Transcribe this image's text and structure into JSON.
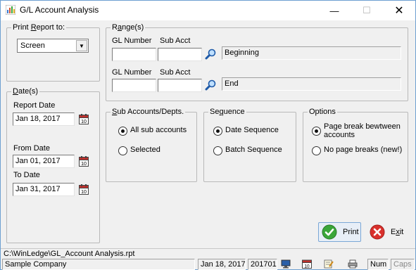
{
  "window": {
    "title": "G/L Account Analysis",
    "min_glyph": "—",
    "max_glyph": "☐",
    "close_glyph": "✕"
  },
  "print_report": {
    "title_prefix": "Print ",
    "title_underlined": "R",
    "title_suffix": "eport to:",
    "selected": "Screen"
  },
  "dates": {
    "title_underlined": "D",
    "title_suffix": "ate(s)",
    "report_date_label": "Report Date",
    "report_date": "Jan 18, 2017",
    "from_date_label": "From Date",
    "from_date": "Jan 01, 2017",
    "to_date_label": "To Date",
    "to_date": "Jan 31, 2017"
  },
  "ranges": {
    "title_prefix": "R",
    "title_underlined": "a",
    "title_suffix": "nge(s)",
    "gl_number_label": "GL Number",
    "sub_acct_label": "Sub Acct",
    "begin_gl": "",
    "begin_sub": "",
    "begin_desc": "Beginning",
    "end_gl": "",
    "end_sub": "",
    "end_desc": "End"
  },
  "sub_accounts": {
    "title_underlined": "S",
    "title_suffix": "ub Accounts/Depts.",
    "options": [
      "All sub accounts",
      "Selected"
    ],
    "selected_index": 0
  },
  "sequence": {
    "title_prefix": "Se",
    "title_underlined": "q",
    "title_suffix": "uence",
    "options": [
      "Date Sequence",
      "Batch Sequence"
    ],
    "selected_index": 0
  },
  "options": {
    "title": "Options",
    "option1_line1": "Page break bewtween",
    "option1_line2": "accounts",
    "option2": "No page breaks (new!)",
    "selected_index": 0
  },
  "buttons": {
    "print_label": "Print",
    "exit_prefix": "E",
    "exit_underlined": "x",
    "exit_suffix": "it"
  },
  "path_bar": {
    "path": "C:\\WinLedge\\GL_Account Analysis.rpt"
  },
  "status_bar": {
    "company": "Sample Company",
    "date": "Jan 18, 2017",
    "period": "201701",
    "num": "Num",
    "caps": "Caps"
  },
  "colors": {
    "accent_border": "#6d9fd1",
    "print_icon_green": "#3aa63a",
    "exit_icon_red": "#d9302c"
  }
}
